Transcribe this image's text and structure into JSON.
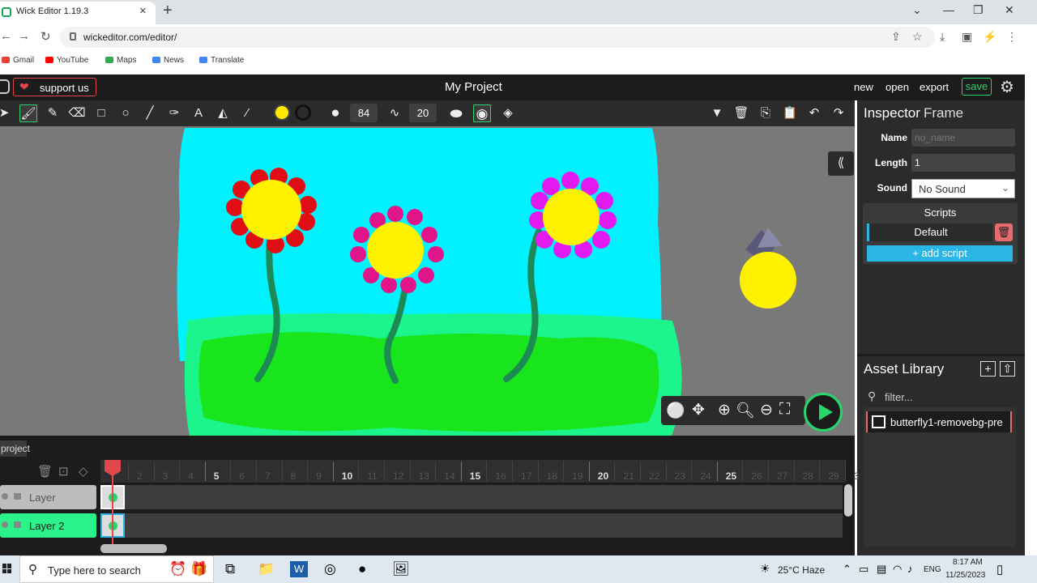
{
  "browser": {
    "tab_title": "Wick Editor 1.19.3",
    "url": "wickeditor.com/editor/",
    "bookmarks": [
      "Gmail",
      "YouTube",
      "Maps",
      "News",
      "Translate"
    ]
  },
  "app": {
    "support_label": "support us",
    "project_title": "My Project",
    "menu": {
      "new": "new",
      "open": "open",
      "export": "export",
      "save": "save"
    }
  },
  "toolbar": {
    "brush_size": "84",
    "smoothing": "20",
    "fill_color": "#ffea00",
    "stroke_color": "#111111"
  },
  "inspector": {
    "title": "Inspector",
    "subtitle": "Frame",
    "name_label": "Name",
    "name_placeholder": "no_name",
    "length_label": "Length",
    "length_value": "1",
    "sound_label": "Sound",
    "sound_value": "No Sound",
    "scripts_header": "Scripts",
    "script_default": "Default",
    "add_script": "+ add script"
  },
  "assets": {
    "title": "Asset Library",
    "filter_placeholder": "filter...",
    "items": [
      "butterfly1-removebg-pre"
    ]
  },
  "timeline": {
    "tab_label": "project",
    "layers": [
      {
        "name": "Layer",
        "active": false
      },
      {
        "name": "Layer 2",
        "active": true
      }
    ],
    "ruler": [
      "2",
      "3",
      "4",
      "5",
      "6",
      "7",
      "8",
      "9",
      "10",
      "11",
      "12",
      "13",
      "14",
      "15",
      "16",
      "17",
      "18",
      "19",
      "20",
      "21",
      "22",
      "23",
      "24",
      "25",
      "26",
      "27",
      "28",
      "29",
      "3"
    ]
  },
  "taskbar": {
    "search_placeholder": "Type here to search",
    "weather": "25°C  Haze",
    "lang": "ENG",
    "time": "8:17 AM",
    "date": "11/25/2023"
  }
}
